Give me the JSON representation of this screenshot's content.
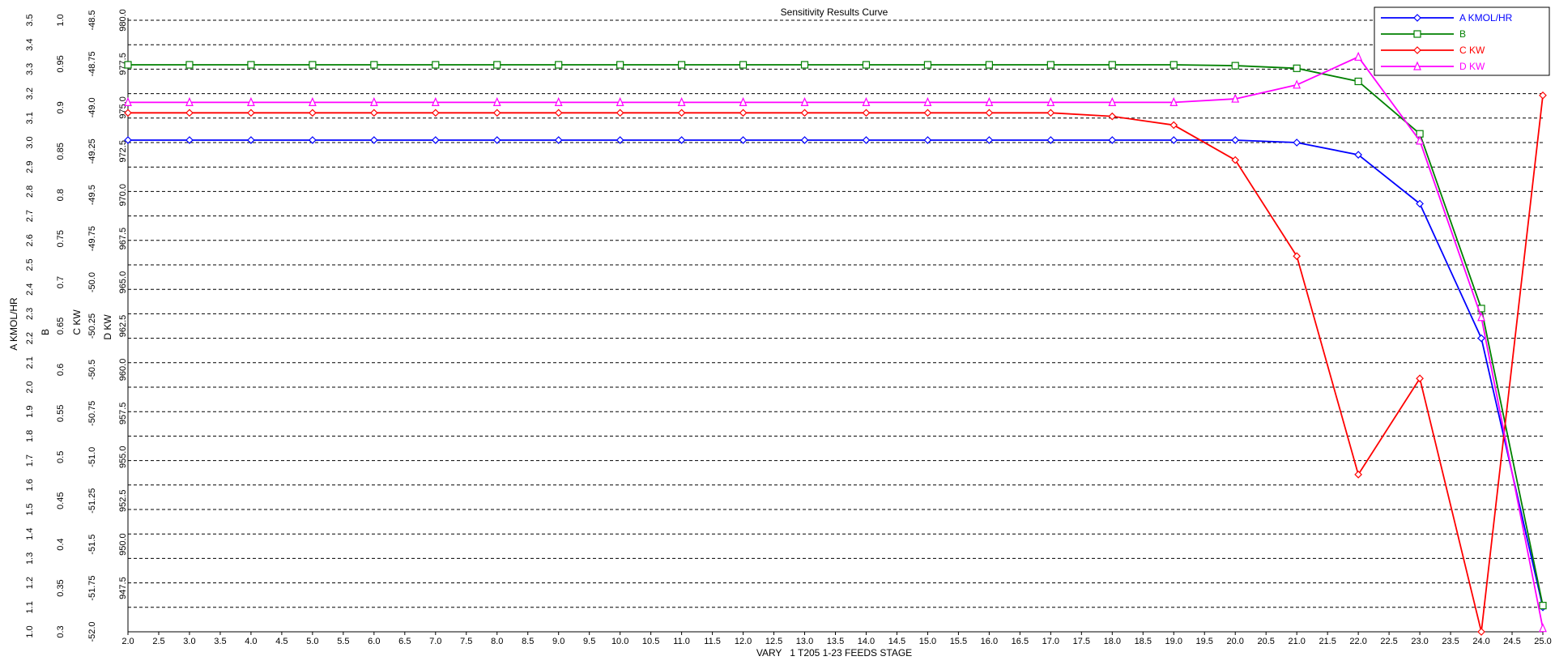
{
  "chart_data": {
    "type": "line",
    "title": "Sensitivity Results Curve",
    "xlabel": "VARY   1 T205 1-23 FEEDS STAGE",
    "xlim": [
      2.0,
      25.0
    ],
    "x_ticks": [
      "2.0",
      "2.5",
      "3.0",
      "3.5",
      "4.0",
      "4.5",
      "5.0",
      "5.5",
      "6.0",
      "6.5",
      "7.0",
      "7.5",
      "8.0",
      "8.5",
      "9.0",
      "9.5",
      "10.0",
      "10.5",
      "11.0",
      "11.5",
      "12.0",
      "12.5",
      "13.0",
      "13.5",
      "14.0",
      "14.5",
      "15.0",
      "15.5",
      "16.0",
      "16.5",
      "17.0",
      "17.5",
      "18.0",
      "18.5",
      "19.0",
      "19.5",
      "20.0",
      "20.5",
      "21.0",
      "21.5",
      "22.0",
      "22.5",
      "23.0",
      "23.5",
      "24.0",
      "24.5",
      "25.0"
    ],
    "grid": true,
    "legend_position": "top-right",
    "x": [
      2,
      3,
      4,
      5,
      6,
      7,
      8,
      9,
      10,
      11,
      12,
      13,
      14,
      15,
      16,
      17,
      18,
      19,
      20,
      21,
      22,
      23,
      24,
      25
    ],
    "axes": [
      {
        "label": "A KMOL/HR",
        "range": [
          1.0,
          3.5
        ],
        "ticks": [
          "1.0",
          "1.1",
          "1.2",
          "1.3",
          "1.4",
          "1.5",
          "1.6",
          "1.7",
          "1.8",
          "1.9",
          "2.0",
          "2.1",
          "2.2",
          "2.3",
          "2.4",
          "2.5",
          "2.6",
          "2.7",
          "2.8",
          "2.9",
          "3.0",
          "3.1",
          "3.2",
          "3.3",
          "3.4",
          "3.5"
        ]
      },
      {
        "label": "B",
        "range": [
          0.3,
          1.0
        ],
        "ticks": [
          "0.3",
          "0.35",
          "0.4",
          "0.45",
          "0.5",
          "0.55",
          "0.6",
          "0.65",
          "0.7",
          "0.75",
          "0.8",
          "0.85",
          "0.9",
          "0.95",
          "1.0"
        ]
      },
      {
        "label": "C KW",
        "range": [
          -52.0,
          -48.5
        ],
        "ticks": [
          "-52.0",
          "-51.75",
          "-51.5",
          "-51.25",
          "-51.0",
          "-50.75",
          "-50.5",
          "-50.25",
          "-50.0",
          "-49.75",
          "-49.5",
          "-49.25",
          "-49.0",
          "-48.75",
          "-48.5"
        ]
      },
      {
        "label": "D KW",
        "range": [
          945.0,
          980.0
        ],
        "ticks": [
          "947.5",
          "950.0",
          "952.5",
          "955.0",
          "957.5",
          "960.0",
          "962.5",
          "965.0",
          "967.5",
          "970.0",
          "972.5",
          "975.0",
          "977.5",
          "980.0"
        ]
      }
    ],
    "series": [
      {
        "name": "A KMOL/HR",
        "axis": 0,
        "color": "#0000ff",
        "marker": "diamond",
        "values": [
          3.01,
          3.01,
          3.01,
          3.01,
          3.01,
          3.01,
          3.01,
          3.01,
          3.01,
          3.01,
          3.01,
          3.01,
          3.01,
          3.01,
          3.01,
          3.01,
          3.01,
          3.01,
          3.01,
          3.0,
          2.95,
          2.75,
          2.2,
          1.1
        ]
      },
      {
        "name": "B",
        "axis": 1,
        "color": "#008000",
        "marker": "square",
        "values": [
          0.949,
          0.949,
          0.949,
          0.949,
          0.949,
          0.949,
          0.949,
          0.949,
          0.949,
          0.949,
          0.949,
          0.949,
          0.949,
          0.949,
          0.949,
          0.949,
          0.949,
          0.949,
          0.948,
          0.945,
          0.93,
          0.87,
          0.67,
          0.33
        ]
      },
      {
        "name": "C KW",
        "axis": 2,
        "color": "#ff0000",
        "marker": "diamond",
        "values": [
          -49.03,
          -49.03,
          -49.03,
          -49.03,
          -49.03,
          -49.03,
          -49.03,
          -49.03,
          -49.03,
          -49.03,
          -49.03,
          -49.03,
          -49.03,
          -49.03,
          -49.03,
          -49.03,
          -49.05,
          -49.1,
          -49.3,
          -49.85,
          -51.1,
          -50.55,
          -52.0,
          -48.93
        ]
      },
      {
        "name": "D KW",
        "axis": 3,
        "color": "#ff00ff",
        "marker": "triangle",
        "values": [
          975.3,
          975.3,
          975.3,
          975.3,
          975.3,
          975.3,
          975.3,
          975.3,
          975.3,
          975.3,
          975.3,
          975.3,
          975.3,
          975.3,
          975.3,
          975.3,
          975.3,
          975.3,
          975.5,
          976.3,
          977.9,
          973.1,
          963.0,
          945.2
        ]
      }
    ]
  }
}
